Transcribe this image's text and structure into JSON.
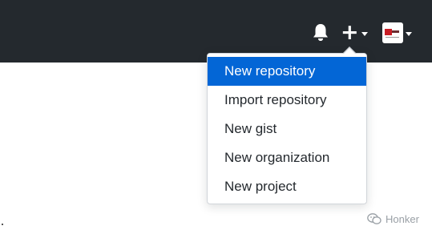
{
  "header": {
    "background": "#24292e",
    "notifications_icon": "bell-icon",
    "create_icon": "plus-icon",
    "avatar_icon": "user-avatar"
  },
  "create_menu": {
    "items": [
      {
        "label": "New repository",
        "active": true
      },
      {
        "label": "Import repository",
        "active": false
      },
      {
        "label": "New gist",
        "active": false
      },
      {
        "label": "New organization",
        "active": false
      },
      {
        "label": "New project",
        "active": false
      }
    ],
    "active_color": "#0366d6"
  },
  "watermark": {
    "text": "Honker",
    "icon": "wechat-icon"
  }
}
